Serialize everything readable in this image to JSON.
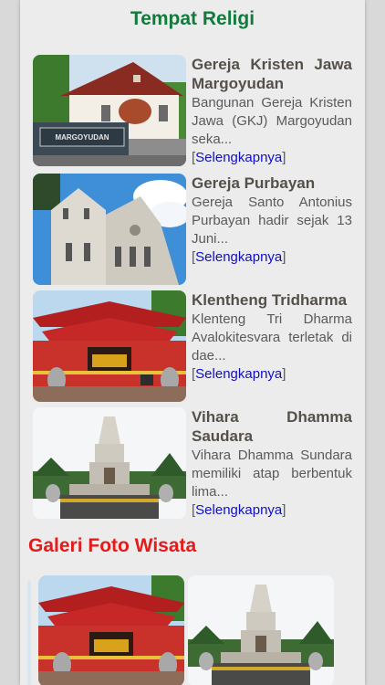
{
  "religi": {
    "title": "Tempat Religi",
    "items": [
      {
        "title": "Gereja Kristen Jawa Margoyudan",
        "description": "Bangunan Gereja Kristen Jawa (GKJ) Margoyudan seka...",
        "link": "Selengkapnya",
        "sign_text": "MARGOYUDAN",
        "image": "church-margoyudan-photo"
      },
      {
        "title": "Gereja Purbayan",
        "description": "Gereja Santo Antonius Purbayan hadir sejak 13 Juni...",
        "link": "Selengkapnya",
        "image": "church-purbayan-photo"
      },
      {
        "title": "Klentheng Tridharma",
        "description": "Klenteng Tri Dharma Avalokitesvara terletak di dae...",
        "link": "Selengkapnya",
        "image": "chinese-temple-photo"
      },
      {
        "title": "Vihara Dhamma Saudara",
        "description": "Vihara Dhamma Sundara memiliki atap berbentuk lima...",
        "link": "Selengkapnya",
        "image": "vihara-stupa-photo"
      }
    ]
  },
  "galeri": {
    "title": "Galeri Foto Wisata",
    "items": [
      {
        "image": "chinese-temple-photo"
      },
      {
        "image": "vihara-stupa-photo"
      }
    ]
  },
  "colors": {
    "religi_title": "#117a3c",
    "galeri_title": "#e31b1b",
    "link": "#1010c0"
  }
}
